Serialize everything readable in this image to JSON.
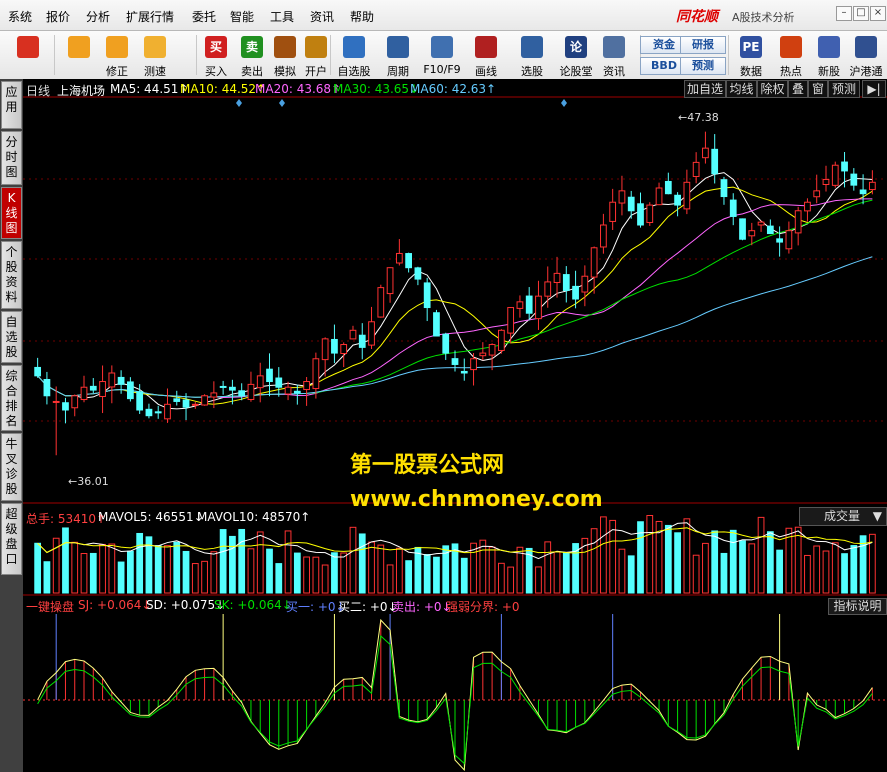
{
  "menu": [
    "系统",
    "报价",
    "分析",
    "扩展行情",
    "委托",
    "智能",
    "工具",
    "资讯",
    "帮助"
  ],
  "brand": "同花顺",
  "brand_sub": "A股技术分析",
  "toolbar": {
    "buttons": [
      {
        "label": "",
        "icon": "windows-grid-icon",
        "color": "#d83020"
      },
      {
        "label": "",
        "icon": "back-arrow-icon",
        "color": "#f0a020"
      },
      {
        "label": "修正",
        "icon": "modify-icon",
        "color": "#f0a020"
      },
      {
        "label": "测速",
        "icon": "speedtest-clock-icon",
        "color": "#f0b030"
      },
      {
        "label": "买入",
        "icon": "buy-icon",
        "color": "#d02020",
        "glyph": "买"
      },
      {
        "label": "卖出",
        "icon": "sell-icon",
        "color": "#209020",
        "glyph": "卖"
      },
      {
        "label": "模拟",
        "icon": "gavel-icon",
        "color": "#a05010"
      },
      {
        "label": "开户",
        "icon": "lock-icon",
        "color": "#c08010"
      },
      {
        "label": "自选股",
        "icon": "star-icon",
        "color": "#3070c0"
      },
      {
        "label": "周期",
        "icon": "period-clock-icon",
        "color": "#3060a0"
      },
      {
        "label": "F10/F9",
        "icon": "f10-icon",
        "color": "#4070b0"
      },
      {
        "label": "画线",
        "icon": "pen-icon",
        "color": "#b02020"
      },
      {
        "label": "选股",
        "icon": "stock-pick-icon",
        "color": "#3060a0"
      },
      {
        "label": "论股堂",
        "icon": "forum-icon",
        "color": "#204080",
        "glyph": "论"
      },
      {
        "label": "资讯",
        "icon": "news-icon",
        "color": "#5070a0"
      },
      {
        "label": "数据",
        "icon": "pe-data-icon",
        "color": "#3050a0",
        "glyph": "PE"
      },
      {
        "label": "热点",
        "icon": "hot-icon",
        "color": "#d04010"
      },
      {
        "label": "新股",
        "icon": "ipo-icon",
        "color": "#4060b0"
      },
      {
        "label": "沪港通",
        "icon": "sse-hkex-icon",
        "color": "#305090"
      }
    ],
    "small_buttons": [
      "资金",
      "研报",
      "BBD",
      "预测"
    ]
  },
  "sidebar": [
    "应用",
    "分时图",
    "K线图",
    "个股资料",
    "自选股",
    "综合排名",
    "牛叉诊股",
    "超级盘口"
  ],
  "chart_header": {
    "period": "日线",
    "stock": "上海机场",
    "ma": [
      {
        "text": "MA5: 44.51↑",
        "color": "#ffffff"
      },
      {
        "text": "MA10: 44.52↑",
        "color": "#ffff00"
      },
      {
        "text": "MA20: 43.68↑",
        "color": "#ff66ff"
      },
      {
        "text": "MA30: 43.65↓",
        "color": "#00e000"
      },
      {
        "text": "MA60: 42.63↑",
        "color": "#66ccff"
      }
    ],
    "right_buttons": [
      "加自选",
      "均线",
      "除权",
      "叠",
      "窗",
      "预测"
    ]
  },
  "price_labels": {
    "high": "47.38",
    "low": "36.01"
  },
  "volume_header": [
    {
      "text": "总手: 53410↑",
      "color": "#ff4040"
    },
    {
      "text": "MAVOL5: 46551↓",
      "color": "#ffffff"
    },
    {
      "text": "MAVOL10: 48570↑",
      "color": "#ffffff"
    }
  ],
  "volume_dropdown": "成交量",
  "indicator_header": [
    {
      "text": "一键操盘",
      "color": "#ff4040"
    },
    {
      "text": "SJ: +0.064↓",
      "color": "#ff4040"
    },
    {
      "text": "SD: +0.075↓",
      "color": "#ffffff"
    },
    {
      "text": "SK: +0.064↓",
      "color": "#00e000"
    },
    {
      "text": "买一: +0↓",
      "color": "#6080ff"
    },
    {
      "text": "买二: +0↓",
      "color": "#ffffff"
    },
    {
      "text": "卖出: +0↓",
      "color": "#ff66ff"
    },
    {
      "text": "强弱分界: +0",
      "color": "#ff4040"
    }
  ],
  "indicator_help": "指标说明",
  "watermark": {
    "line1": "第一股票公式网",
    "line2": "www.chnmoney.com"
  },
  "chart_data": {
    "type": "candlestick",
    "ylim": [
      35,
      48
    ],
    "high_mark": 47.38,
    "low_mark": 36.01,
    "closes": [
      38.8,
      38.1,
      37.9,
      37.6,
      38.1,
      38.4,
      38.3,
      38.6,
      38.9,
      38.5,
      38.0,
      37.6,
      37.4,
      37.5,
      37.8,
      37.9,
      37.7,
      37.8,
      38.1,
      38.2,
      38.4,
      38.3,
      38.1,
      38.5,
      38.8,
      38.6,
      38.4,
      38.4,
      38.2,
      38.6,
      39.4,
      40.1,
      39.6,
      39.9,
      40.4,
      39.8,
      40.7,
      41.9,
      42.6,
      43.1,
      42.6,
      42.2,
      41.2,
      40.2,
      39.6,
      39.2,
      38.9,
      39.4,
      39.6,
      39.9,
      40.4,
      41.2,
      41.4,
      41.0,
      41.6,
      42.1,
      42.4,
      41.8,
      41.5,
      42.3,
      43.3,
      44.1,
      44.9,
      45.3,
      44.6,
      44.1,
      44.8,
      45.4,
      45.2,
      44.8,
      45.6,
      46.3,
      46.8,
      45.9,
      45.1,
      44.4,
      43.6,
      43.9,
      44.2,
      43.8,
      43.5,
      43.9,
      44.6,
      44.9,
      45.3,
      45.7,
      46.2,
      46.0,
      45.5,
      45.2,
      45.6
    ]
  }
}
